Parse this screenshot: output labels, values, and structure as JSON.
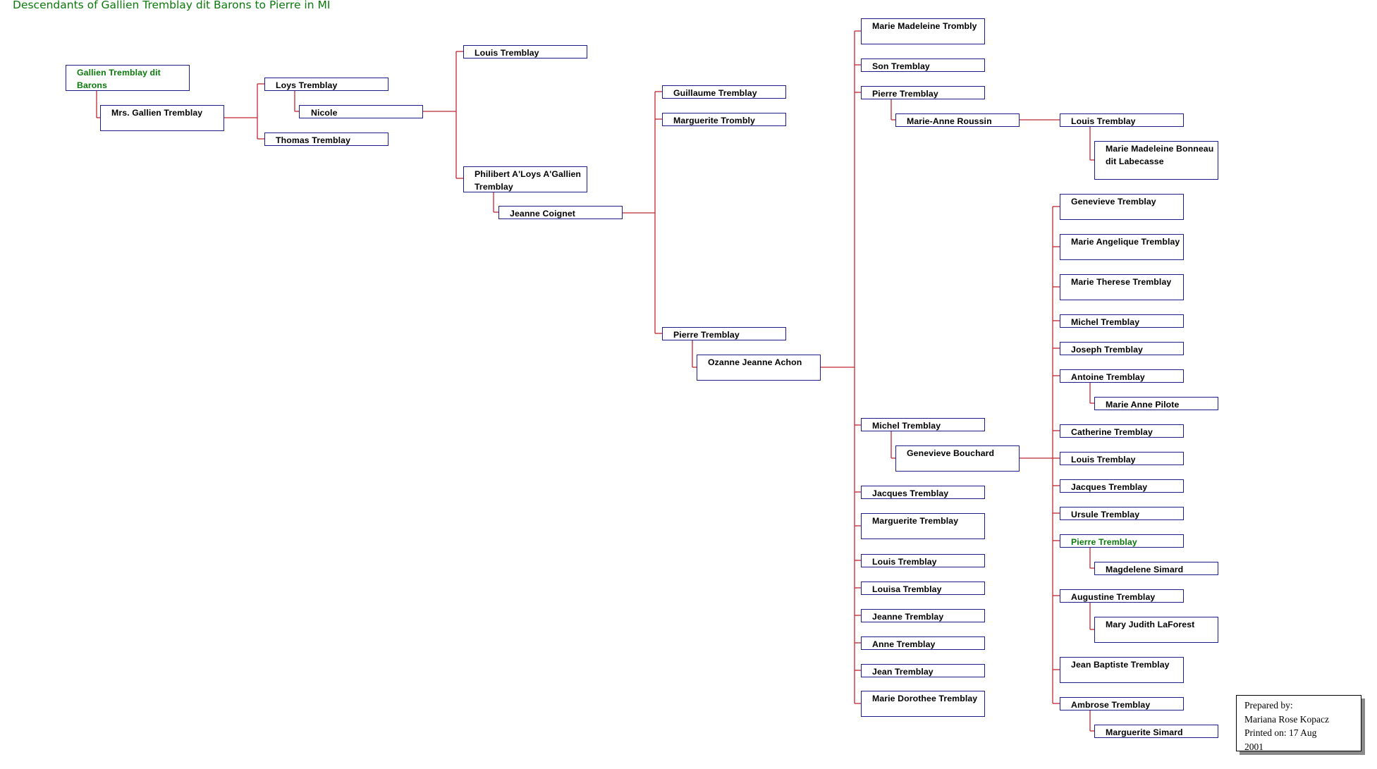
{
  "title": "Descendants of Gallien Tremblay dit Barons to Pierre in MI",
  "colors": {
    "title": "#0a7a0a",
    "highlight_name": "#0a7a0a",
    "box_border": "#1c1c8a",
    "connector": "#c02630"
  },
  "people": {
    "g1_gallien": "Gallien Tremblay dit Barons",
    "g1_spouse": "Mrs. Gallien Tremblay",
    "g2_loys": "Loys Tremblay",
    "g2_loys_spouse": "Nicole",
    "g2_thomas": "Thomas Tremblay",
    "g3_louis": "Louis Tremblay",
    "g3_philibert": "Philibert A'Loys A'Gallien Tremblay",
    "g3_philibert_spouse": "Jeanne Coignet",
    "g4_guillaume": "Guillaume Tremblay",
    "g4_marguerite": "Marguerite Trombly",
    "g4_pierre": "Pierre Tremblay",
    "g4_pierre_spouse": "Ozanne Jeanne Achon",
    "g5_marie_madeleine": "Marie Madeleine Trombly",
    "g5_son": "Son Tremblay",
    "g5_pierre": "Pierre Tremblay",
    "g5_pierre_spouse": "Marie-Anne Roussin",
    "g5_michel": "Michel Tremblay",
    "g5_michel_spouse": "Genevieve Bouchard",
    "g5_jacques": "Jacques Tremblay",
    "g5_marguerite": "Marguerite Tremblay",
    "g5_louis": "Louis Tremblay",
    "g5_louisa": "Louisa Tremblay",
    "g5_jeanne": "Jeanne Tremblay",
    "g5_anne": "Anne Tremblay",
    "g5_jean": "Jean Tremblay",
    "g5_marie_dorothee": "Marie Dorothee Tremblay",
    "g6_louis_a": "Louis Tremblay",
    "g6_louis_a_spouse": "Marie Madeleine Bonneau dit Labecasse",
    "g6_genevieve": "Genevieve Tremblay",
    "g6_marie_angelique": "Marie Angelique Tremblay",
    "g6_marie_therese": "Marie Therese Tremblay",
    "g6_michel": "Michel Tremblay",
    "g6_joseph": "Joseph Tremblay",
    "g6_antoine": "Antoine Tremblay",
    "g6_antoine_spouse": "Marie Anne Pilote",
    "g6_catherine": "Catherine Tremblay",
    "g6_louis_b": "Louis Tremblay",
    "g6_jacques": "Jacques Tremblay",
    "g6_ursule": "Ursule Tremblay",
    "g6_pierre": "Pierre Tremblay",
    "g6_pierre_spouse": "Magdelene Simard",
    "g6_augustine": "Augustine Tremblay",
    "g6_augustine_spouse": "Mary Judith LaForest",
    "g6_jean_baptiste": "Jean Baptiste Tremblay",
    "g6_ambrose": "Ambrose Tremblay",
    "g6_ambrose_spouse": "Marguerite Simard"
  },
  "prepared": {
    "line1": "Prepared by:",
    "line2": "Mariana Rose Kopacz",
    "line3": "Printed on: 17 Aug",
    "line4": "2001"
  }
}
